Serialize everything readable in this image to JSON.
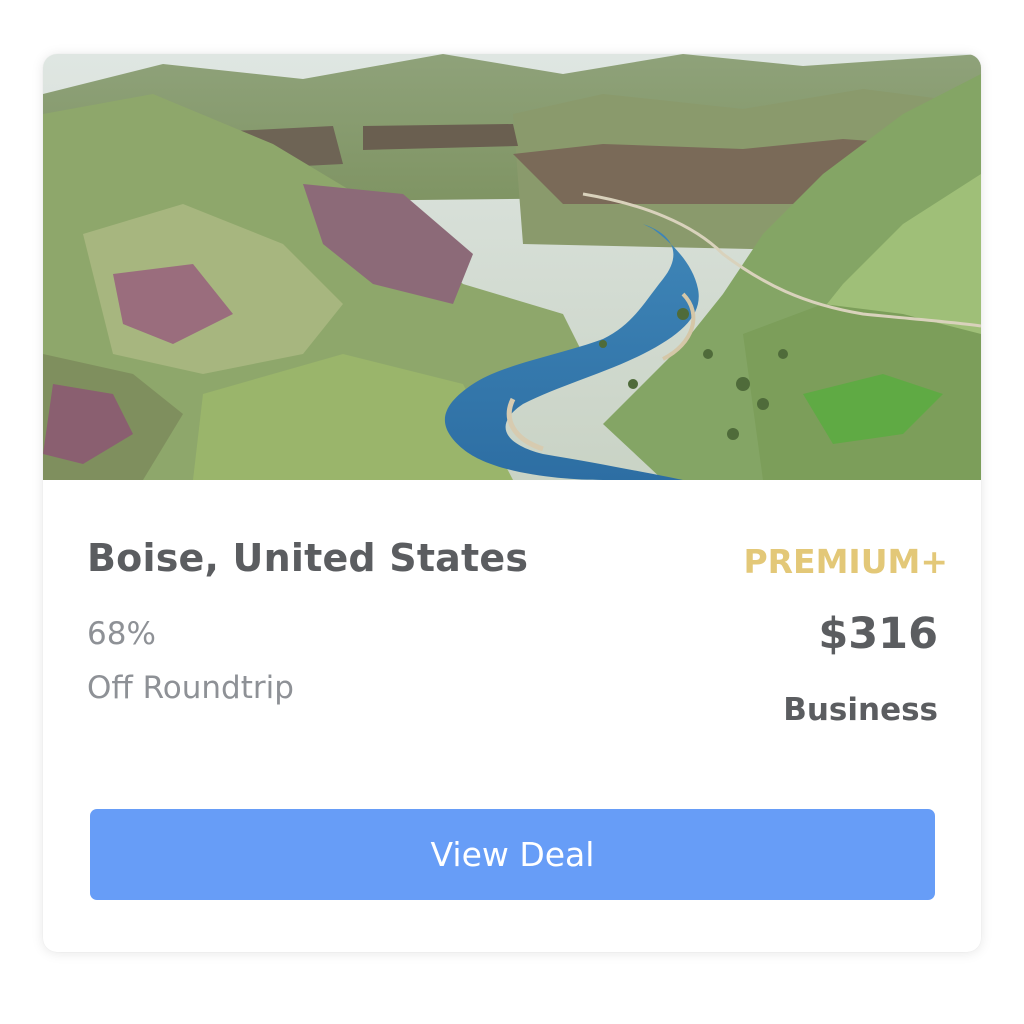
{
  "deal": {
    "destination": "Boise, United States",
    "tier": "PREMIUM+",
    "discount": "68%",
    "trip_type": "Off Roundtrip",
    "price": "$316",
    "cabin_class": "Business",
    "cta_label": "View Deal"
  },
  "colors": {
    "accent_button": "#679df7",
    "tier_gold": "#e3c878",
    "heading_text": "#5b5d60",
    "muted_text": "#8e9196"
  }
}
